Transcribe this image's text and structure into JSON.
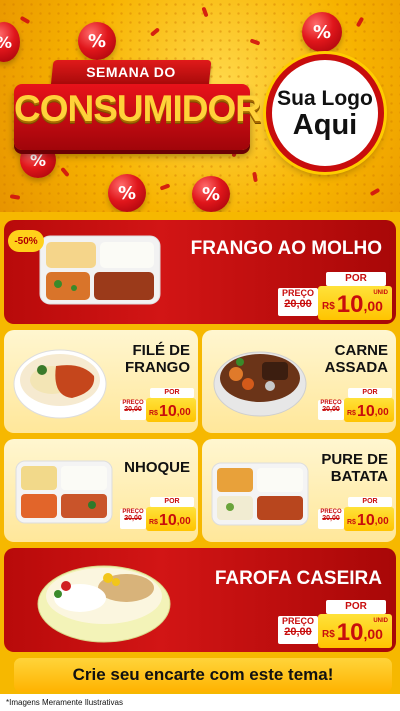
{
  "hero": {
    "title_top": "SEMANA DO",
    "title_main": "CONSUMIDOR",
    "logo_line1": "Sua Logo",
    "logo_line2": "Aqui",
    "percent_symbol": "%"
  },
  "discount_badge": "-50%",
  "price_labels": {
    "por": "POR",
    "preco": "PREÇO",
    "old_price": "20,00",
    "currency": "R$",
    "new_price_int": "10",
    "new_price_dec": ",00",
    "unit": "UNID"
  },
  "products": [
    {
      "name_line1": "FRANGO AO MOLHO",
      "name_line2": ""
    },
    {
      "name_line1": "FILÉ DE",
      "name_line2": "FRANGO"
    },
    {
      "name_line1": "CARNE",
      "name_line2": "ASSADA"
    },
    {
      "name_line1": "NHOQUE",
      "name_line2": ""
    },
    {
      "name_line1": "PURE DE",
      "name_line2": "BATATA"
    },
    {
      "name_line1": "FAROFA CASEIRA",
      "name_line2": ""
    }
  ],
  "cta": "Crie seu encarte com este tema!",
  "footer": "*Imagens Meramente Ilustrativas",
  "colors": {
    "red": "#c80d0d",
    "yellow": "#ffc400",
    "cream": "#fff6d0"
  }
}
